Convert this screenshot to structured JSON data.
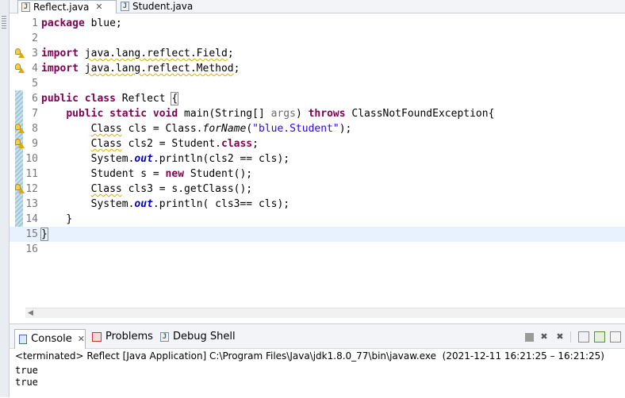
{
  "editor_tabs": [
    {
      "label": "Reflect.java",
      "close": "✕",
      "active": true
    },
    {
      "label": "Student.java",
      "active": false
    }
  ],
  "java_icon_letter": "J",
  "editor": {
    "lines": [
      {
        "n": "1"
      },
      {
        "n": "2"
      },
      {
        "n": "3"
      },
      {
        "n": "4"
      },
      {
        "n": "5"
      },
      {
        "n": "6"
      },
      {
        "n": "7"
      },
      {
        "n": "8"
      },
      {
        "n": "9"
      },
      {
        "n": "10"
      },
      {
        "n": "11"
      },
      {
        "n": "12"
      },
      {
        "n": "13"
      },
      {
        "n": "14"
      },
      {
        "n": "15"
      },
      {
        "n": "16"
      }
    ],
    "tokens": {
      "package_kw": "package",
      "package_name": " blue;",
      "import_kw": "import",
      "import3": "java.lang.reflect.Field",
      "import4": "java.lang.reflect.Method",
      "semicolon": ";",
      "public_kw": "public",
      "class_kw": "class",
      "class_name": " Reflect ",
      "open_brace": "{",
      "static_kw": "static",
      "void_kw": "void",
      "main_sig": " main(String[] ",
      "args": "args",
      "close_paren": ") ",
      "throws_kw": "throws",
      "exception": " ClassNotFoundException{",
      "Class": "Class",
      "cls_decl": " cls = Class.",
      "forName": "forName",
      "paren_open": "(",
      "student_str": "\"blue.Student\"",
      "paren_close_semi": ");",
      "cls2_decl": " cls2 = Student.",
      "class_lit": "class",
      "sysout": "System.",
      "out": "out",
      "println_cls2": ".println(cls2 == cls);",
      "student_decl": "Student s = ",
      "new_kw": "new",
      "student_ctor": " Student();",
      "cls3_decl": " cls3 = s.getClass();",
      "println_cls3": ".println( cls3== cls);",
      "close_brace": "}"
    }
  },
  "console": {
    "tabs": [
      {
        "label": "Console",
        "close": "✕"
      },
      {
        "label": "Problems"
      },
      {
        "label": "Debug Shell"
      }
    ],
    "status": "<terminated> Reflect [Java Application] C:\\Program Files\\Java\\jdk1.8.0_77\\bin\\javaw.exe  (2021-12-11 16:21:25 – 16:21:25)",
    "output": [
      "true",
      "true"
    ],
    "toolbar_icons": [
      "terminate-icon",
      "remove-launch-icon",
      "remove-all-terminated-icon",
      "scroll-lock-icon",
      "pin-console-icon",
      "display-console-icon"
    ]
  },
  "colors": {
    "keyword": "#7f0055",
    "string": "#2a00ff",
    "field": "#0000c0",
    "current_line": "#e8f2fe",
    "line_number": "#787878"
  }
}
